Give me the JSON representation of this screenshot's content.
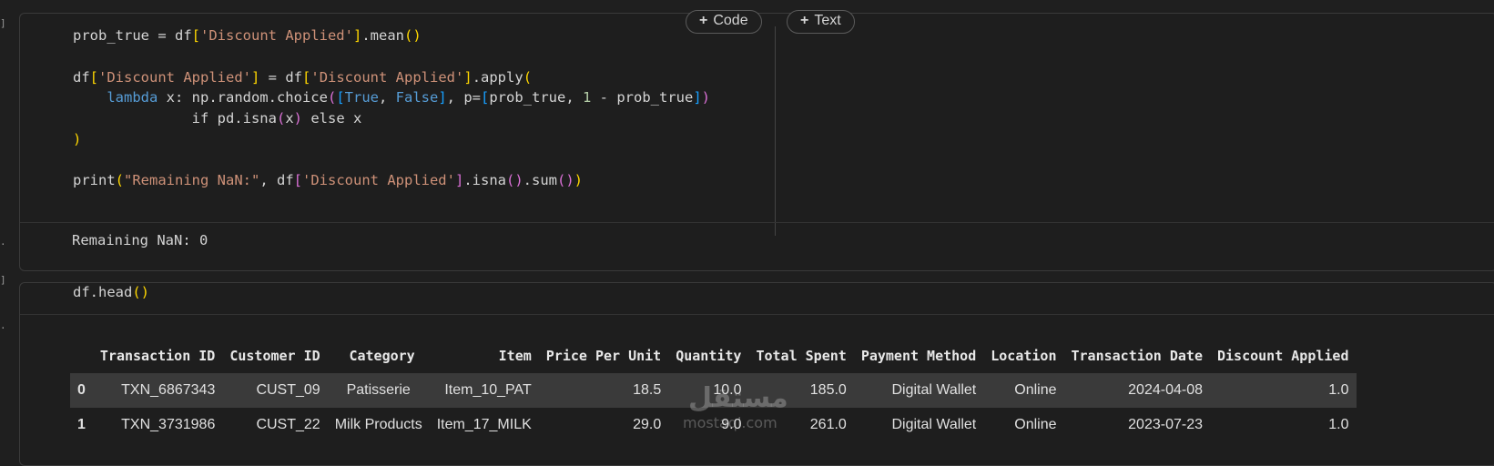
{
  "toolbar": {
    "add_code_label": "Code",
    "add_text_label": "Text"
  },
  "cell1": {
    "lines": [
      [
        "prob_true = df",
        "[",
        "'Discount Applied'",
        "]",
        ".mean",
        "()"
      ],
      [],
      [
        "df",
        "[",
        "'Discount Applied'",
        "]",
        " = df",
        "[",
        "'Discount Applied'",
        "]",
        ".apply",
        "("
      ],
      [
        "    ",
        "lambda",
        " x: np.random.choice",
        "(",
        "[",
        "True",
        ", ",
        "False",
        "]",
        ", p=",
        "[",
        "prob_true, ",
        "1",
        " - prob_true",
        "]",
        ")"
      ],
      [
        "              if pd.isna",
        "(",
        "x",
        ")",
        " else x"
      ],
      [
        ")"
      ],
      [],
      [
        "print",
        "(",
        "\"Remaining NaN:\"",
        ", df",
        "[",
        "'Discount Applied'",
        "]",
        ".isna",
        "()",
        ".sum",
        "()",
        ")"
      ]
    ],
    "output": "Remaining NaN: 0"
  },
  "cell2": {
    "code": "df.head()",
    "code_parts": [
      "df.head",
      "(",
      ")"
    ],
    "table": {
      "columns": [
        "",
        "Transaction ID",
        "Customer ID",
        "Category",
        "Item",
        "Price Per Unit",
        "Quantity",
        "Total Spent",
        "Payment Method",
        "Location",
        "Transaction Date",
        "Discount Applied"
      ],
      "rows": [
        [
          "0",
          "TXN_6867343",
          "CUST_09",
          "Patisserie",
          "Item_10_PAT",
          "18.5",
          "10.0",
          "185.0",
          "Digital Wallet",
          "Online",
          "2024-04-08",
          "1.0"
        ],
        [
          "1",
          "TXN_3731986",
          "CUST_22",
          "Milk Products",
          "Item_17_MILK",
          "29.0",
          "9.0",
          "261.0",
          "Digital Wallet",
          "Online",
          "2023-07-23",
          "1.0"
        ]
      ]
    }
  },
  "watermark": {
    "logo": "مستقل",
    "site": "mostaql.com"
  }
}
